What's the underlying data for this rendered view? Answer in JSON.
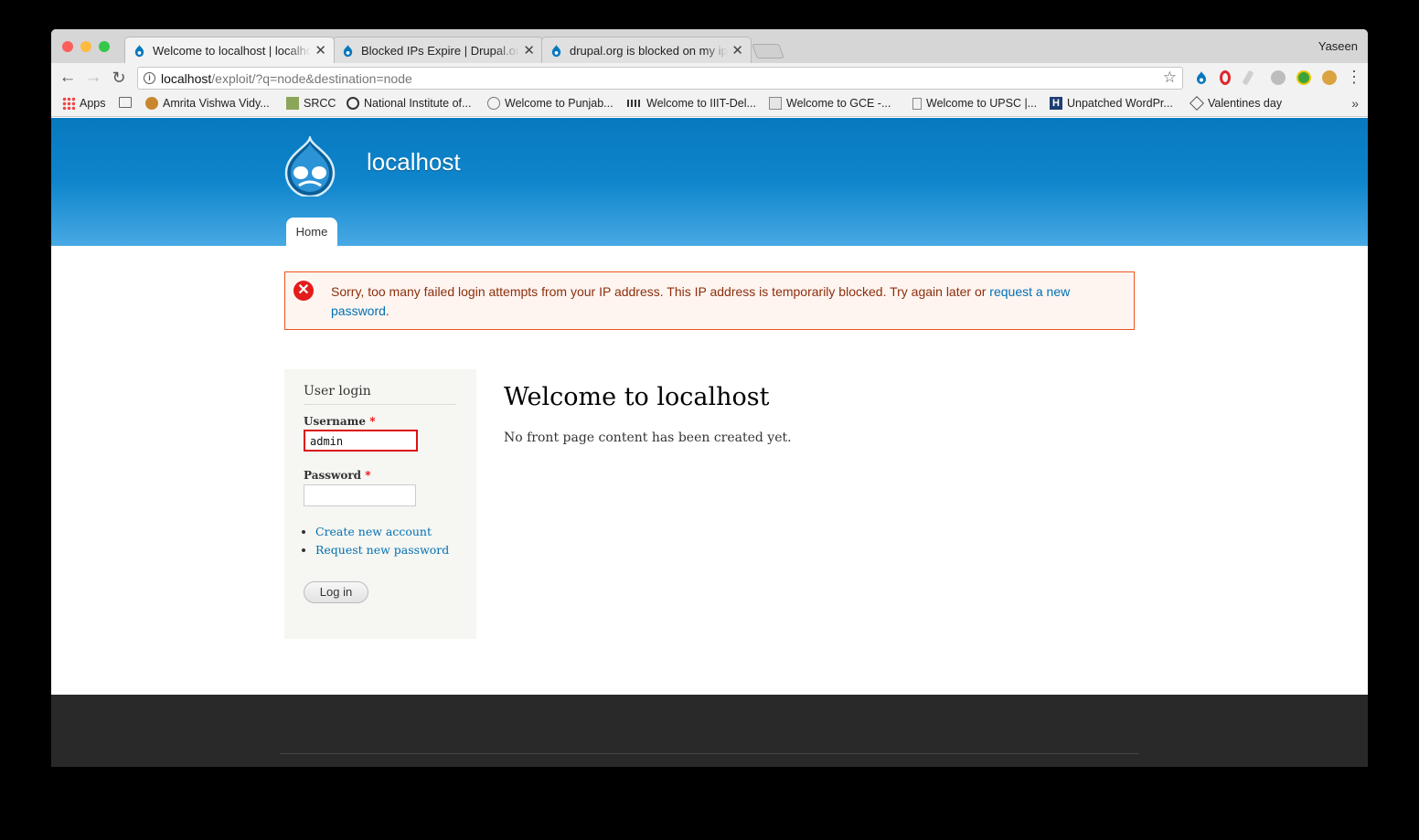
{
  "browser": {
    "profile_name": "Yaseen",
    "tabs": [
      {
        "title": "Welcome to localhost | localhost",
        "active": true
      },
      {
        "title": "Blocked IPs Expire | Drupal.org",
        "active": false
      },
      {
        "title": "drupal.org is blocked on my ip",
        "active": false
      }
    ],
    "close_glyph": "✕",
    "url_host": "localhost",
    "url_rest": "/exploit/?q=node&destination=node",
    "bookmarks": [
      {
        "label": "Apps",
        "icon": "apps-grid-icon"
      },
      {
        "label": "",
        "icon": "folder-icon"
      },
      {
        "label": "Amrita Vishwa Vidy...",
        "icon": "amrita-icon"
      },
      {
        "label": "SRCC",
        "icon": "srcc-icon"
      },
      {
        "label": "National Institute of...",
        "icon": "nit-icon"
      },
      {
        "label": "Welcome to Punjab...",
        "icon": "punjab-icon"
      },
      {
        "label": "Welcome to IIIT-Del...",
        "icon": "iiit-icon"
      },
      {
        "label": "Welcome to GCE -...",
        "icon": "gce-icon"
      },
      {
        "label": "Welcome to UPSC |...",
        "icon": "page-icon"
      },
      {
        "label": "Unpatched WordPr...",
        "icon": "h-icon"
      },
      {
        "label": "Valentines day",
        "icon": "codepen-icon"
      }
    ],
    "bookmarks_more": "»"
  },
  "site": {
    "name": "localhost",
    "nav_home": "Home"
  },
  "error": {
    "text_before": "Sorry, too many failed login attempts from your IP address. This IP address is temporarily blocked. Try again later or ",
    "link_text": "request a new password",
    "text_after": "."
  },
  "login": {
    "title": "User login",
    "username_label": "Username",
    "username_value": "admin",
    "password_label": "Password",
    "required_mark": "*",
    "links": [
      "Create new account",
      "Request new password"
    ],
    "submit": "Log in"
  },
  "content": {
    "title": "Welcome to localhost",
    "body": "No front page content has been created yet."
  },
  "colors": {
    "header_top": "#0779bf",
    "header_bottom": "#48a9e4",
    "error_border": "#ed541d",
    "error_bg": "#fef5f1",
    "error_text": "#8c2e0b",
    "link": "#0071b3",
    "footer": "#292929"
  }
}
